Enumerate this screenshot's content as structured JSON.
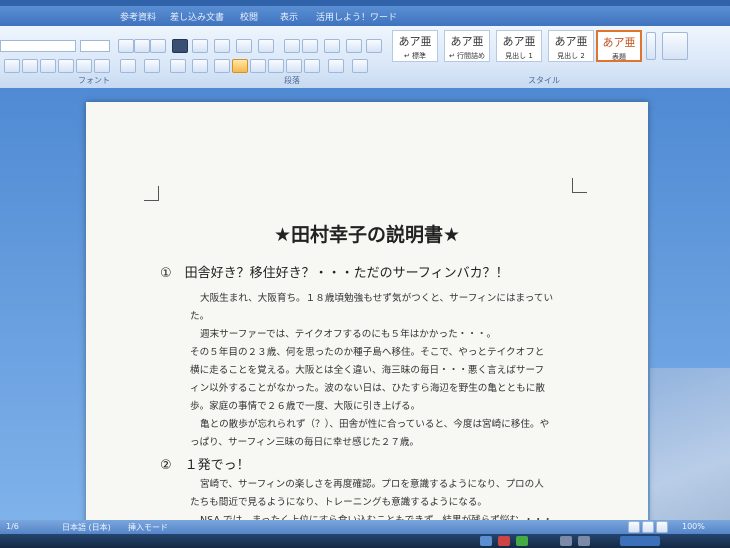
{
  "ribbon": {
    "tabs": [
      "参考資料",
      "差し込み文書",
      "校閲",
      "表示",
      "活用しよう！ワード"
    ],
    "groups": {
      "font": "フォント",
      "paragraph": "段落",
      "styles": "スタイル"
    },
    "styles": [
      {
        "sample": "あア亜",
        "name": "↵ 標準"
      },
      {
        "sample": "あア亜",
        "name": "↵ 行間詰め"
      },
      {
        "sample": "あア亜",
        "name": "見出し 1"
      },
      {
        "sample": "あア亜",
        "name": "見出し 2"
      },
      {
        "sample": "あア亜",
        "name": "表題"
      }
    ]
  },
  "document": {
    "title": "★田村幸子の説明書★",
    "sections": [
      {
        "heading": "①　田舎好き？移住好き？・・・ただのサーフィンバカ？！"
      },
      {
        "heading": "②　１発でっ！"
      }
    ],
    "lines": [
      "大阪生まれ、大阪育ち。１８歳頃勉強もせず気がつくと、サーフィンにはまってい",
      "た。",
      "週末サーファーでは、テイクオフするのにも５年はかかった・・・。",
      "その５年目の２３歳、何を思ったのか種子島へ移住。そこで、やっとテイクオフと",
      "横に走ることを覚える。大阪とは全く違い、海三昧の毎日・・・悪く言えばサーフ",
      "ィン以外することがなかった。波のない日は、ひたすら海辺を野生の亀とともに散",
      "歩。家庭の事情で２６歳で一度、大阪に引き上げる。",
      "亀との散歩が忘れられず（？）、田舎が性に合っていると、今度は宮崎に移住。や",
      "っぱり、サーフィン三昧の毎日に幸せ感じた２７歳。",
      "宮崎で、サーフィンの楽しさを再度確認。プロを意識するようになり、プロの人",
      "たちも間近で見るようになり、トレーニングも意識するようになる。",
      "NSA では、まったく上位にすら食い込むこともできず、結果が残らず悩む。・・・"
    ]
  },
  "status": {
    "page": "1/6",
    "language": "日本語 (日本)",
    "mode": "挿入モード",
    "zoom": "100%"
  }
}
